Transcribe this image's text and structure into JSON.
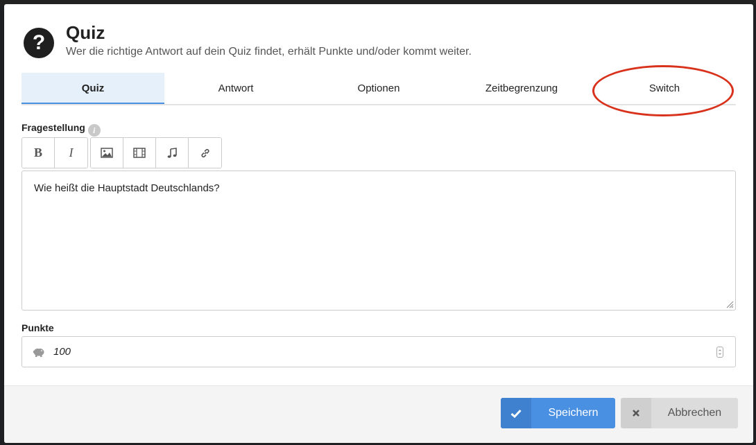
{
  "modal": {
    "title": "Quiz",
    "subtitle": "Wer die richtige Antwort auf dein Quiz findet, erhält Punkte und/oder kommt weiter."
  },
  "tabs": [
    {
      "label": "Quiz",
      "active": true
    },
    {
      "label": "Antwort",
      "active": false
    },
    {
      "label": "Optionen",
      "active": false
    },
    {
      "label": "Zeitbegrenzung",
      "active": false
    },
    {
      "label": "Switch",
      "active": false,
      "highlighted": true
    }
  ],
  "question": {
    "label": "Fragestellung",
    "toolbar": {
      "bold": "B",
      "italic": "I",
      "icons": [
        "image-icon",
        "film-icon",
        "music-icon",
        "link-icon"
      ]
    },
    "text": "Wie heißt die Hauptstadt Deutschlands?"
  },
  "points": {
    "label": "Punkte",
    "value": "100"
  },
  "footer": {
    "save_label": "Speichern",
    "cancel_label": "Abbrechen"
  },
  "colors": {
    "accent": "#4a90e2",
    "active_tab_bg": "#e6f0fb",
    "highlight": "#d9321c"
  }
}
